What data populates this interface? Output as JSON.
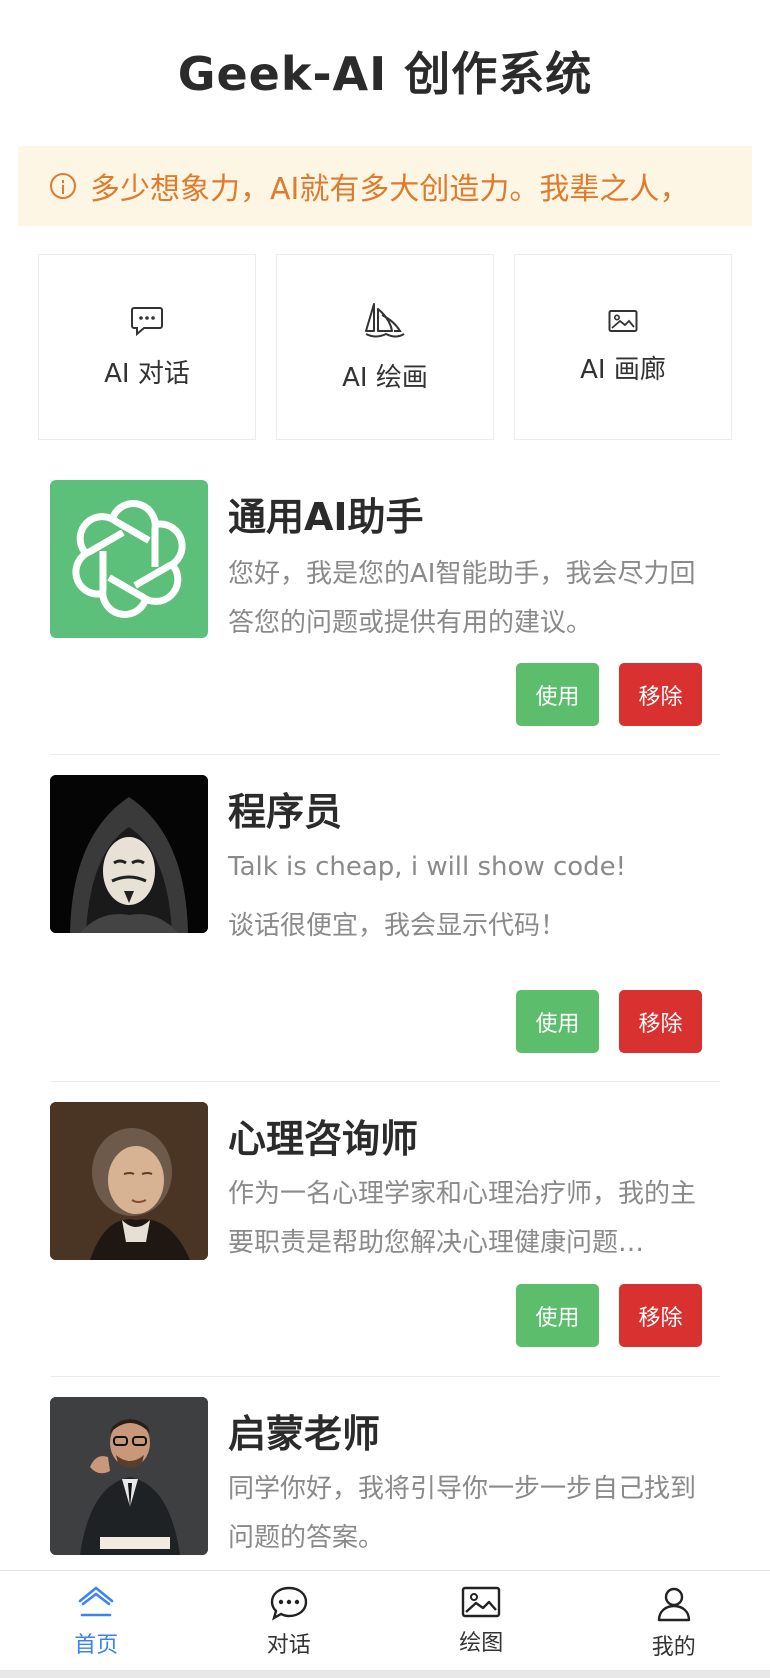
{
  "header": {
    "title": "Geek-AI 创作系统"
  },
  "notice": {
    "icon": "info-circle-icon",
    "text": "多少想象力，AI就有多大创造力。我辈之人，",
    "color": "#e07a2c"
  },
  "quick_nav": [
    {
      "label": "AI 对话",
      "icon": "chat-bubble-icon"
    },
    {
      "label": "AI 绘画",
      "icon": "sailboat-icon"
    },
    {
      "label": "AI 画廊",
      "icon": "image-icon"
    }
  ],
  "roles": [
    {
      "title": "通用AI助手",
      "desc": "您好，我是您的AI智能助手，我会尽力回答您的问题或提供有用的建议。",
      "desc2": "",
      "avatar": "openai-logo"
    },
    {
      "title": "程序员",
      "desc": "Talk is cheap, i will show code!",
      "desc2": "谈话很便宜，我会显示代码！",
      "avatar": "hooded-mask-avatar"
    },
    {
      "title": "心理咨询师",
      "desc": "作为一名心理学家和心理治疗师，我的主要职责是帮助您解决心理健康问题…",
      "desc2": "",
      "avatar": "portrait-avatar"
    },
    {
      "title": "启蒙老师",
      "desc": "同学你好，我将引导你一步一步自己找到问题的答案。",
      "desc2": "",
      "avatar": "teacher-avatar"
    }
  ],
  "buttons": {
    "use": "使用",
    "remove": "移除",
    "use_color": "#5cbd6c",
    "remove_color": "#d9312f"
  },
  "tabbar": {
    "active_color": "#3b82f6",
    "items": [
      {
        "label": "首页",
        "icon": "home-icon",
        "active": true
      },
      {
        "label": "对话",
        "icon": "chat-icon",
        "active": false
      },
      {
        "label": "绘图",
        "icon": "image-icon",
        "active": false
      },
      {
        "label": "我的",
        "icon": "user-icon",
        "active": false
      }
    ]
  }
}
